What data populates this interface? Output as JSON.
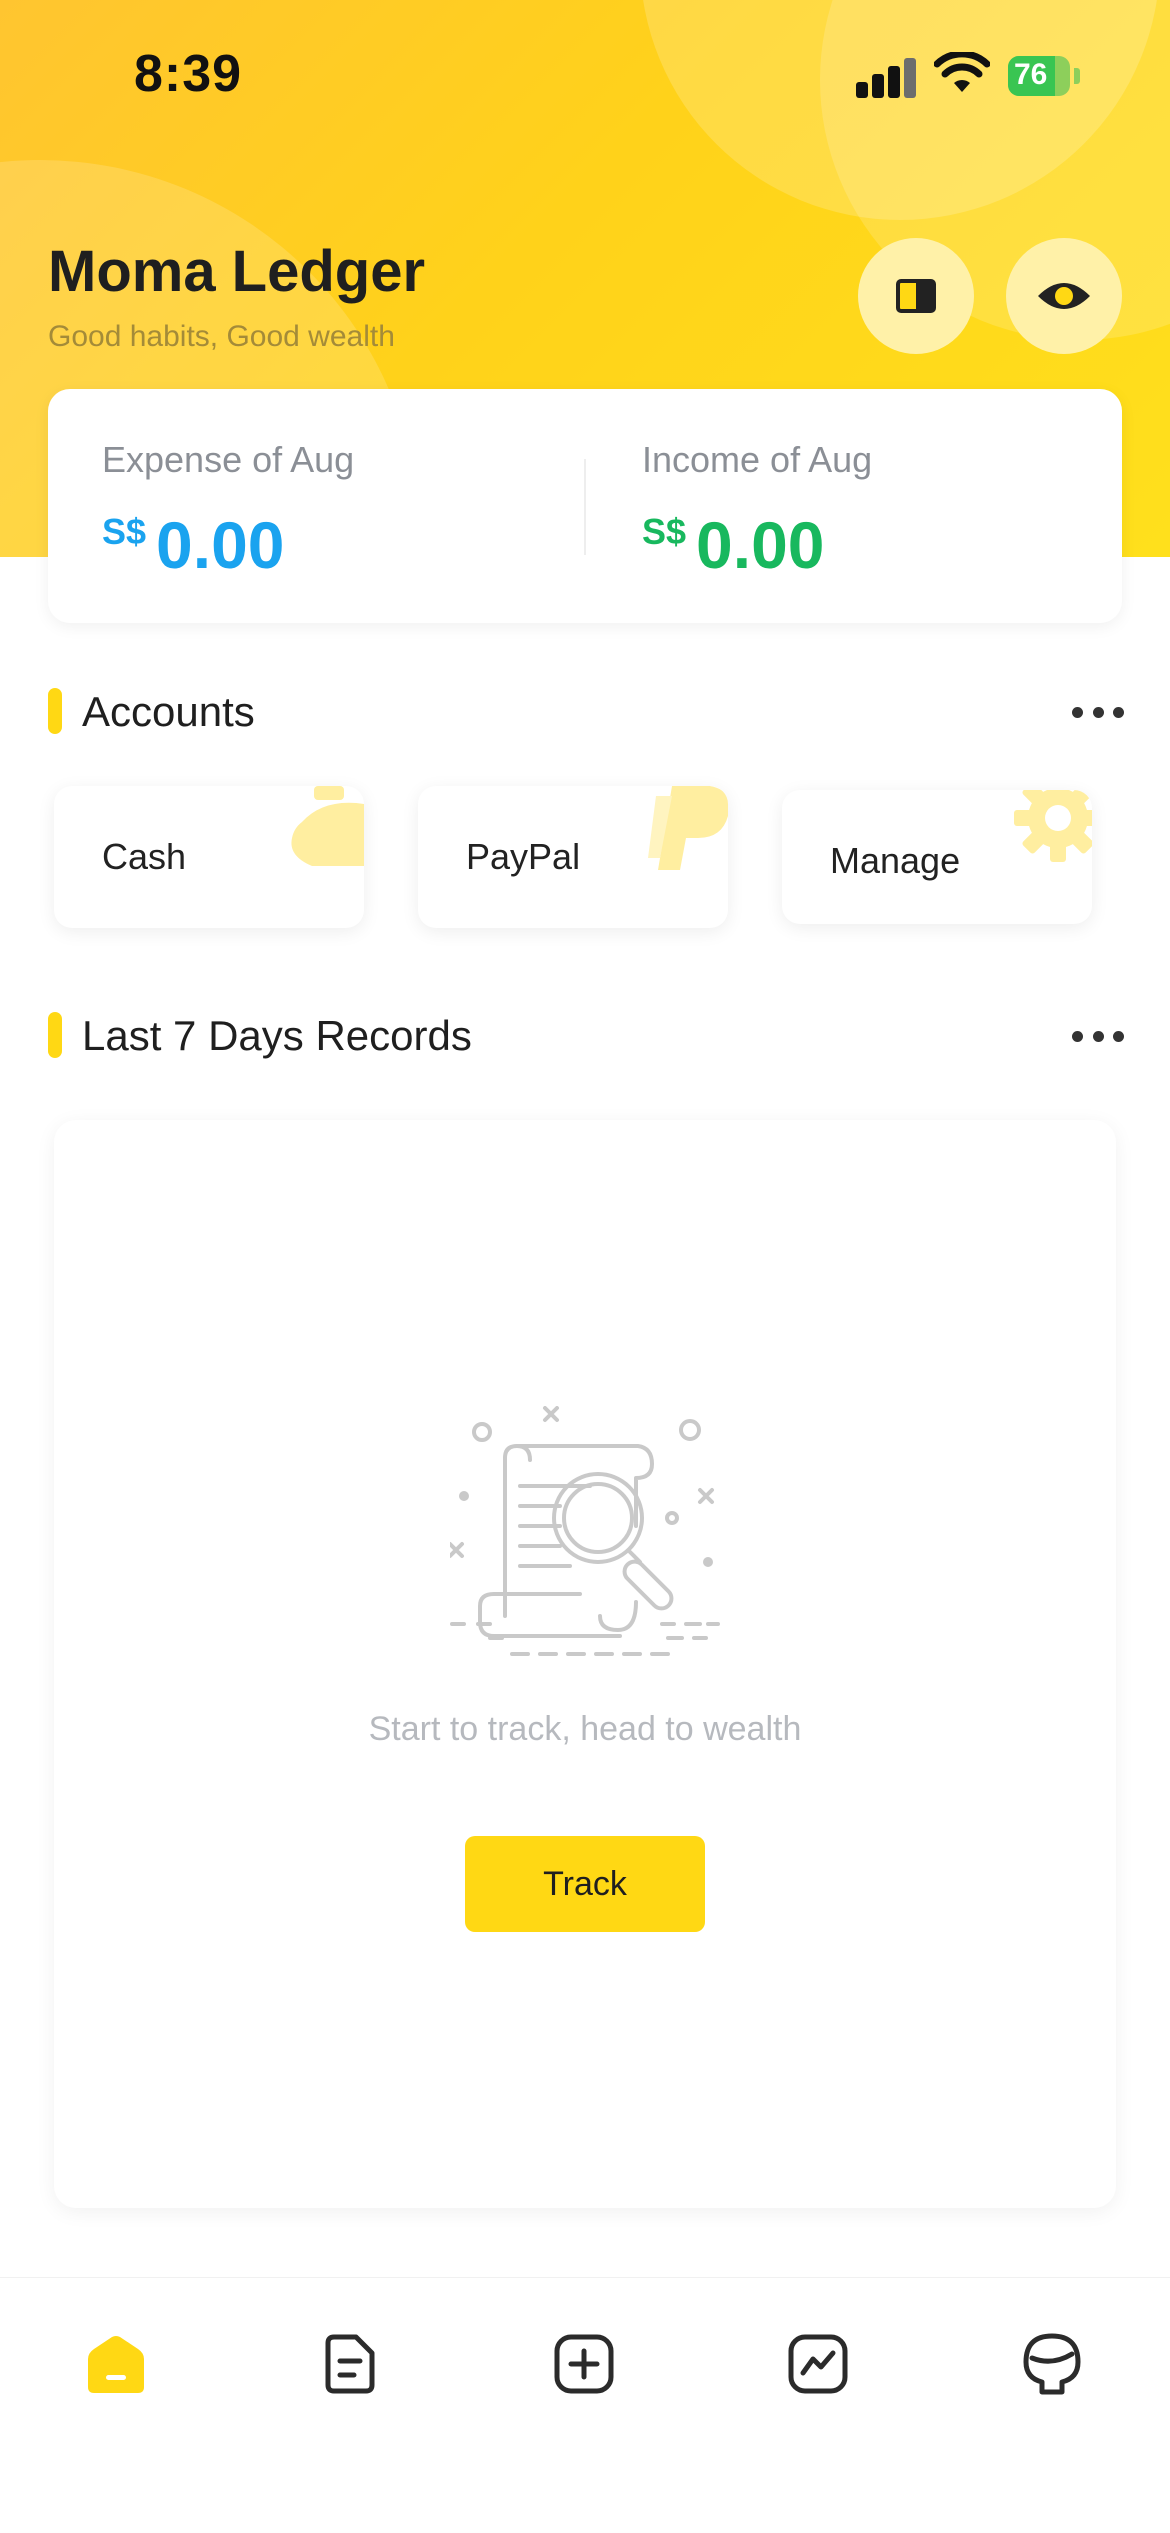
{
  "status_bar": {
    "time": "8:39",
    "battery": "76"
  },
  "header": {
    "title": "Moma Ledger",
    "subtitle": "Good habits, Good wealth"
  },
  "summary": {
    "expense": {
      "label": "Expense of Aug",
      "currency": "S$",
      "amount": "0.00",
      "color": "#1aa3ef"
    },
    "income": {
      "label": "Income of Aug",
      "currency": "S$",
      "amount": "0.00",
      "color": "#18b85e"
    }
  },
  "accounts": {
    "title": "Accounts",
    "items": [
      {
        "label": "Cash",
        "icon": "money-bag-icon"
      },
      {
        "label": "PayPal",
        "icon": "paypal-icon"
      },
      {
        "label": "Manage",
        "icon": "gear-icon"
      }
    ]
  },
  "records": {
    "title": "Last 7 Days Records",
    "empty_text": "Start to track, head to wealth",
    "track_label": "Track"
  },
  "tabbar": {
    "items": [
      {
        "icon": "home-icon",
        "active": true
      },
      {
        "icon": "document-icon",
        "active": false
      },
      {
        "icon": "add-icon",
        "active": false
      },
      {
        "icon": "chart-icon",
        "active": false
      },
      {
        "icon": "profile-icon",
        "active": false
      }
    ]
  },
  "colors": {
    "accent": "#ffd814",
    "text": "#1f1f1f"
  }
}
